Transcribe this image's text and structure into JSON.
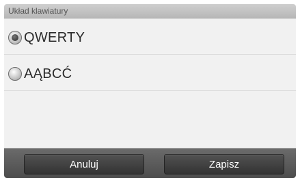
{
  "header": {
    "title": "Układ klawiatury"
  },
  "options": [
    {
      "label": "QWERTY",
      "selected": true
    },
    {
      "label": "AĄBCĆ",
      "selected": false
    }
  ],
  "footer": {
    "cancel_label": "Anuluj",
    "save_label": "Zapisz"
  }
}
